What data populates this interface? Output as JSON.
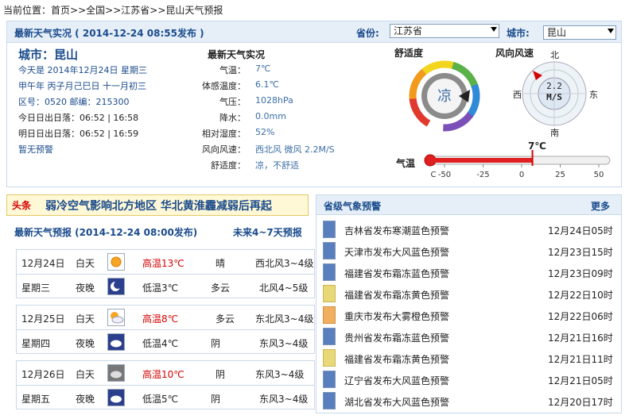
{
  "breadcrumb": {
    "prefix": "当前位置：",
    "home": "首页",
    "country": "全国",
    "province": "江苏省",
    "current": "昆山天气预报",
    "sep": ">>"
  },
  "live": {
    "title": "最新天气实况 ( 2014-12-24  08:55发布 )",
    "province_label": "省份:",
    "province_value": "江苏省",
    "city_label": "城市:",
    "city_value": "昆山",
    "city_name": "城市：昆山",
    "today": "今天是 2014年12月24日  星期三",
    "lunar": "甲午年  丙子月己巳日  十一月初三",
    "codes": "区号：0520  邮编：215300",
    "today_sun": "今日日出日落：06:52 | 16:58",
    "tomorrow_sun": "明日日出日落：06:52 | 16:59",
    "warning": "暂无预警",
    "obs_title": "最新天气实况",
    "obs": [
      {
        "label": "气温：",
        "value": "7℃"
      },
      {
        "label": "体感温度：",
        "value": "6.1℃"
      },
      {
        "label": "气压：",
        "value": "1028hPa"
      },
      {
        "label": "降水：",
        "value": "0.0mm"
      },
      {
        "label": "相对湿度：",
        "value": "52%"
      },
      {
        "label": "风向风速：",
        "value": "西北风 微风 2.2M/S"
      },
      {
        "label": "舒适度：",
        "value": "凉，不舒适"
      }
    ],
    "comfort_title": "舒适度",
    "comfort_value": "凉",
    "wind_title": "风向风速",
    "wind_value": "2.2",
    "wind_unit": "M/S",
    "compass": {
      "n": "北",
      "s": "南",
      "e": "东",
      "w": "西"
    },
    "temp_label": "气温",
    "temp_value": "7℃",
    "temp_value_num": 7,
    "temp_range": [
      -50,
      50
    ],
    "temp_ticks": [
      "C",
      "-50",
      "-25",
      "0",
      "25",
      "50"
    ]
  },
  "headline": {
    "tag": "头条",
    "text": "弱冷空气影响北方地区  华北黄淮霾减弱后再起"
  },
  "forecast": {
    "title": "最新天气预报 (2014-12-24  08:00发布)",
    "more": "未来4~7天预报",
    "days": [
      {
        "date": "12月24日",
        "week": "星期三",
        "day": {
          "period": "白天",
          "icon": "sun-icon",
          "temp": "高温13℃",
          "weather": "晴",
          "wind": "西北风3~4级"
        },
        "night": {
          "period": "夜晚",
          "icon": "moon-icon",
          "temp": "低温3℃",
          "weather": "多云",
          "wind": "北风4~5级"
        }
      },
      {
        "date": "12月25日",
        "week": "星期四",
        "day": {
          "period": "白天",
          "icon": "partly-cloudy-icon",
          "temp": "高温8℃",
          "weather": "多云",
          "wind": "东北风3~4级"
        },
        "night": {
          "period": "夜晚",
          "icon": "overcast-night-icon",
          "temp": "低温4℃",
          "weather": "阴",
          "wind": "东风3~4级"
        }
      },
      {
        "date": "12月26日",
        "week": "星期五",
        "day": {
          "period": "白天",
          "icon": "overcast-icon",
          "temp": "高温10℃",
          "weather": "阴",
          "wind": "东风3~4级"
        },
        "night": {
          "period": "夜晚",
          "icon": "overcast-night-icon",
          "temp": "低温5℃",
          "weather": "阴",
          "wind": "东风3~4级"
        }
      }
    ]
  },
  "alerts": {
    "title": "省级气象预警",
    "more": "更多",
    "items": [
      {
        "text": "吉林省发布寒潮蓝色预警",
        "date": "12月24日05时",
        "color": "blue"
      },
      {
        "text": "天津市发布大风蓝色预警",
        "date": "12月23日15时",
        "color": "blue"
      },
      {
        "text": "福建省发布霜冻蓝色预警",
        "date": "12月23日09时",
        "color": "blue"
      },
      {
        "text": "福建省发布霜冻黄色预警",
        "date": "12月22日10时",
        "color": "yellow"
      },
      {
        "text": "重庆市发布大雾橙色预警",
        "date": "12月22日06时",
        "color": "orange"
      },
      {
        "text": "贵州省发布霜冻蓝色预警",
        "date": "12月21日16时",
        "color": "blue"
      },
      {
        "text": "福建省发布霜冻黄色预警",
        "date": "12月21日11时",
        "color": "yellow"
      },
      {
        "text": "辽宁省发布大风蓝色预警",
        "date": "12月21日05时",
        "color": "blue"
      },
      {
        "text": "湖北省发布大风蓝色预警",
        "date": "12月20日17时",
        "color": "blue"
      }
    ]
  },
  "colors": {
    "accent_blue": "#1a4b8c",
    "red": "#d40000",
    "header_bg": "#e6eff8",
    "border": "#c9d9ea"
  }
}
